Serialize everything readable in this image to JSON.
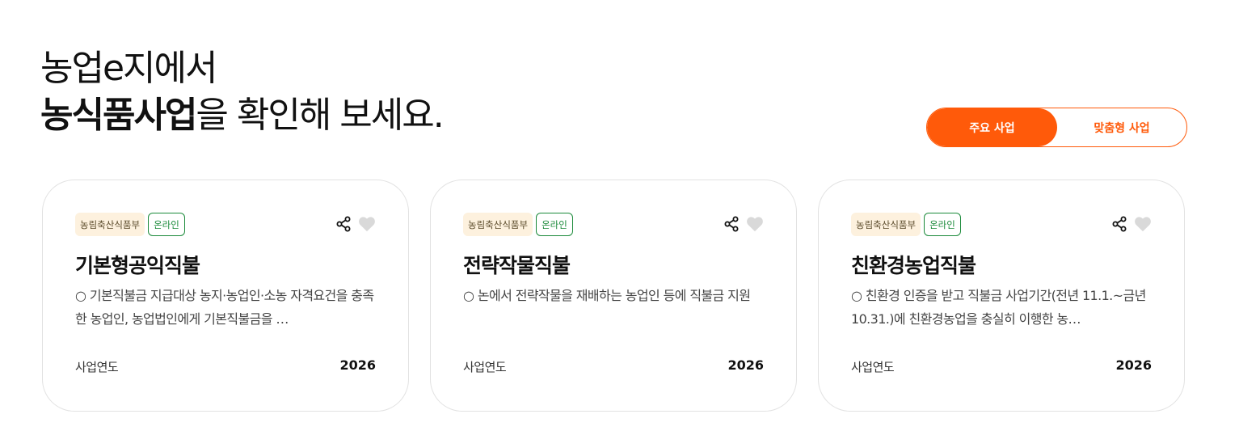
{
  "heading": {
    "line1": "농업e지에서",
    "line2_bold": "농식품사업",
    "line2_rest": "을 확인해 보세요."
  },
  "toggle": {
    "active_label": "주요 사업",
    "inactive_label": "맞춤형 사업"
  },
  "colors": {
    "accent": "#ff5a0a",
    "online_badge": "#1b8a3a",
    "ministry_badge_bg": "#fdf1de"
  },
  "cards": [
    {
      "ministry": "농림축산식품부",
      "channel": "온라인",
      "title": "기본형공익직불",
      "description": "○ 기본직불금 지급대상 농지·농업인·소농 자격요건을 충족한 농업인, 농업법인에게 기본직불금을 …",
      "year_label": "사업연도",
      "year": "2026",
      "share_icon": "share-icon",
      "like_icon": "heart-icon"
    },
    {
      "ministry": "농림축산식품부",
      "channel": "온라인",
      "title": "전략작물직불",
      "description": "○ 논에서 전략작물을 재배하는 농업인 등에 직불금 지원",
      "year_label": "사업연도",
      "year": "2026",
      "share_icon": "share-icon",
      "like_icon": "heart-icon"
    },
    {
      "ministry": "농림축산식품부",
      "channel": "온라인",
      "title": "친환경농업직불",
      "description": "○ 친환경 인증을 받고 직불금 사업기간(전년 11.1.~금년 10.31.)에 친환경농업을 충실히 이행한 농…",
      "year_label": "사업연도",
      "year": "2026",
      "share_icon": "share-icon",
      "like_icon": "heart-icon"
    }
  ]
}
